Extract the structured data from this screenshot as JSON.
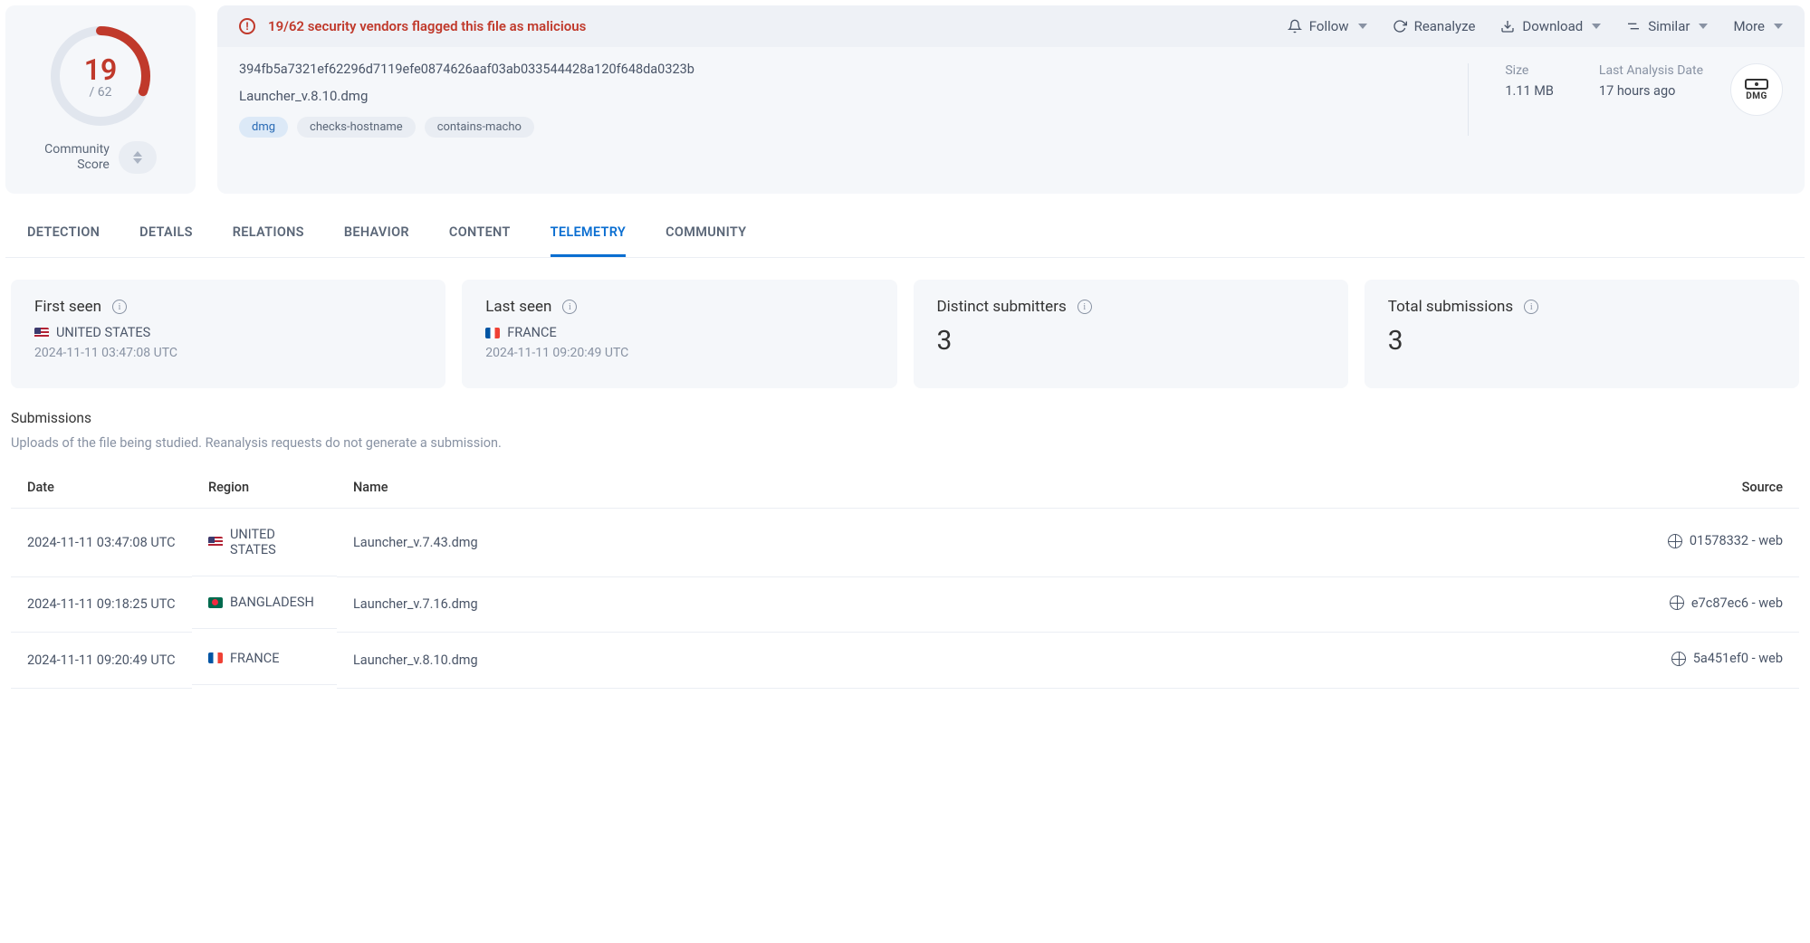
{
  "score": {
    "malicious": "19",
    "total": "/ 62",
    "community_label": "Community\nScore"
  },
  "alert": {
    "text": "19/62 security vendors flagged this file as malicious"
  },
  "actions": {
    "follow": "Follow",
    "reanalyze": "Reanalyze",
    "download": "Download",
    "similar": "Similar",
    "more": "More"
  },
  "file": {
    "hash": "394fb5a7321ef62296d7119efe0874626aaf03ab033544428a120f648da0323b",
    "name": "Launcher_v.8.10.dmg",
    "tags": [
      "dmg",
      "checks-hostname",
      "contains-macho"
    ],
    "size_label": "Size",
    "size_value": "1.11 MB",
    "last_analysis_label": "Last Analysis Date",
    "last_analysis_value": "17 hours ago",
    "type_badge": "DMG"
  },
  "tabs": [
    "DETECTION",
    "DETAILS",
    "RELATIONS",
    "BEHAVIOR",
    "CONTENT",
    "TELEMETRY",
    "COMMUNITY"
  ],
  "active_tab": "TELEMETRY",
  "stats": {
    "first_seen": {
      "title": "First seen",
      "country": "UNITED STATES",
      "flag": "us",
      "time": "2024-11-11 03:47:08 UTC"
    },
    "last_seen": {
      "title": "Last seen",
      "country": "FRANCE",
      "flag": "fr",
      "time": "2024-11-11 09:20:49 UTC"
    },
    "distinct": {
      "title": "Distinct submitters",
      "value": "3"
    },
    "total": {
      "title": "Total submissions",
      "value": "3"
    }
  },
  "submissions": {
    "title": "Submissions",
    "subtitle": "Uploads of the file being studied. Reanalysis requests do not generate a submission.",
    "columns": {
      "date": "Date",
      "region": "Region",
      "name": "Name",
      "source": "Source"
    },
    "rows": [
      {
        "date": "2024-11-11 03:47:08 UTC",
        "flag": "us",
        "region": "UNITED STATES",
        "name": "Launcher_v.7.43.dmg",
        "source": "01578332 - web"
      },
      {
        "date": "2024-11-11 09:18:25 UTC",
        "flag": "bd",
        "region": "BANGLADESH",
        "name": "Launcher_v.7.16.dmg",
        "source": "e7c87ec6 - web"
      },
      {
        "date": "2024-11-11 09:20:49 UTC",
        "flag": "fr",
        "region": "FRANCE",
        "name": "Launcher_v.8.10.dmg",
        "source": "5a451ef0 - web"
      }
    ]
  }
}
